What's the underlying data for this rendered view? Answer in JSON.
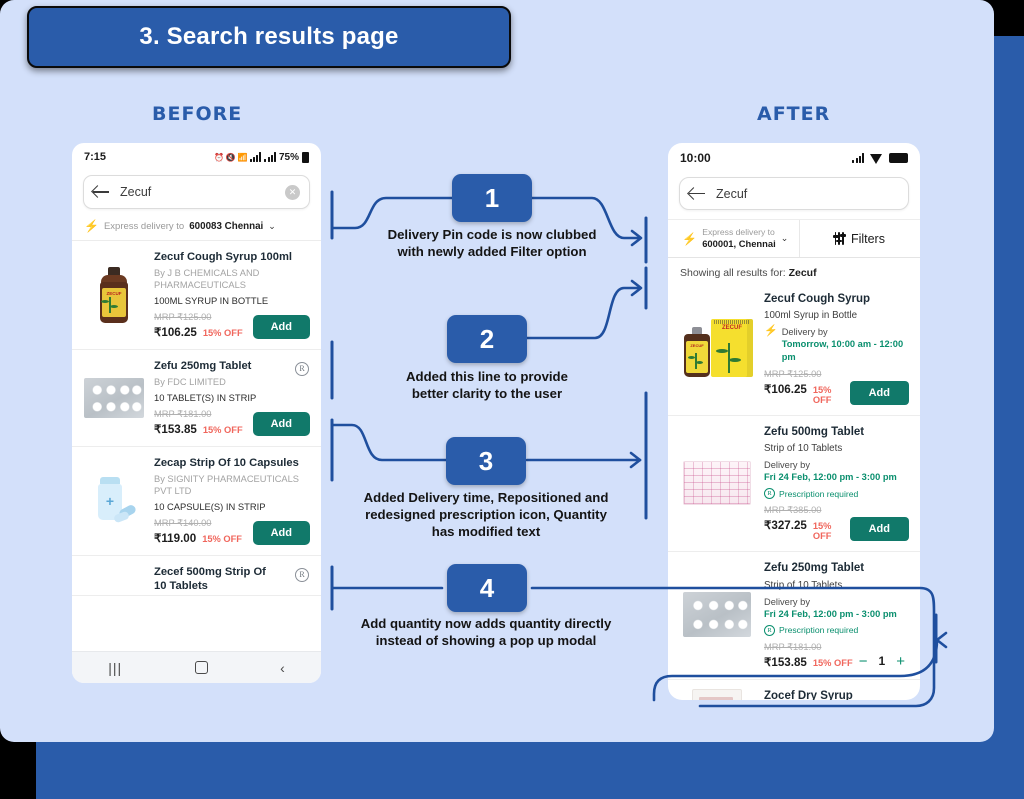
{
  "title": "3. Search results page",
  "columns": {
    "before": "BEFORE",
    "after": "AFTER"
  },
  "annotations": [
    {
      "number": "1",
      "text": "Delivery Pin code is now clubbed\nwith newly added Filter option"
    },
    {
      "number": "2",
      "text": "Added this line to provide\nbetter clarity to the user"
    },
    {
      "number": "3",
      "text": "Added Delivery time, Repositioned and\nredesigned prescription icon, Quantity\nhas modified text"
    },
    {
      "number": "4",
      "text": "Add quantity now adds quantity directly\ninstead of showing a pop up modal"
    }
  ],
  "before_phone": {
    "status": {
      "time": "7:15",
      "battery": "75%"
    },
    "search": {
      "value": "Zecuf",
      "placeholder": "Search"
    },
    "express": {
      "label": "Express delivery to",
      "value": "600083 Chennai"
    },
    "products": [
      {
        "name": "Zecuf Cough Syrup 100ml",
        "by": "By J B CHEMICALS AND PHARMACEUTICALS",
        "pack": "100ML SYRUP IN BOTTLE",
        "mrp": "MRP ₹125.00",
        "price": "₹106.25",
        "off": "15% OFF",
        "add": "Add",
        "rx": false
      },
      {
        "name": "Zefu 250mg Tablet",
        "by": "By FDC LIMITED",
        "pack": "10 TABLET(S) IN STRIP",
        "mrp": "MRP ₹181.00",
        "price": "₹153.85",
        "off": "15% OFF",
        "add": "Add",
        "rx": true
      },
      {
        "name": "Zecap Strip Of 10 Capsules",
        "by": "By SIGNITY PHARMACEUTICALS PVT LTD",
        "pack": "10 CAPSULE(S) IN STRIP",
        "mrp": "MRP ₹140.00",
        "price": "₹119.00",
        "off": "15% OFF",
        "add": "Add",
        "rx": false
      },
      {
        "name": "Zecef 500mg Strip Of 10 Tablets",
        "by": "",
        "pack": "",
        "mrp": "",
        "price": "",
        "off": "",
        "add": "",
        "rx": true
      }
    ],
    "navbar": {
      "recents": "|||",
      "home": "home-square",
      "back": "‹"
    }
  },
  "after_phone": {
    "status": {
      "time": "10:00"
    },
    "search": {
      "value": "Zecuf",
      "placeholder": "Search"
    },
    "delivery_cell": {
      "label": "Express delivery to",
      "value": "600001, Chennai"
    },
    "filters_label": "Filters",
    "showing": {
      "prefix": "Showing all results for: ",
      "query": "Zecuf"
    },
    "products": [
      {
        "name": "Zecuf Cough Syrup",
        "pack": "100ml Syrup in Bottle",
        "delivery_label": "Delivery by",
        "delivery_value": "Tomorrow, 10:00 am - 12:00 pm",
        "express_bolt": true,
        "rx_text": "",
        "mrp": "MRP ₹125.00",
        "price": "₹106.25",
        "off": "15% OFF",
        "action": "Add",
        "qty": ""
      },
      {
        "name": "Zefu 500mg Tablet",
        "pack": "Strip of 10 Tablets",
        "delivery_label": "Delivery by",
        "delivery_value": "Fri 24 Feb, 12:00 pm - 3:00 pm",
        "express_bolt": false,
        "rx_text": "Prescription required",
        "mrp": "MRP ₹385.00",
        "price": "₹327.25",
        "off": "15% OFF",
        "action": "Add",
        "qty": ""
      },
      {
        "name": "Zefu 250mg Tablet",
        "pack": "Strip of 10 Tablets",
        "delivery_label": "Delivery by",
        "delivery_value": "Fri 24 Feb, 12:00 pm - 3:00 pm",
        "express_bolt": false,
        "rx_text": "Prescription required",
        "mrp": "MRP ₹181.00",
        "price": "₹153.85",
        "off": "15% OFF",
        "action": "",
        "qty": "1"
      },
      {
        "name": "Zocef Dry Syrup",
        "pack": "",
        "delivery_label": "",
        "delivery_value": "",
        "express_bolt": false,
        "rx_text": "",
        "mrp": "",
        "price": "",
        "off": "",
        "action": "",
        "qty": ""
      }
    ]
  },
  "colors": {
    "brand_blue": "#2a5caa",
    "card_bg": "#d3e0fa",
    "add_green": "#11796a",
    "delivery_green": "#0a8f6e",
    "discount_red": "#f0665c",
    "bolt_yellow": "#f6b41a"
  }
}
